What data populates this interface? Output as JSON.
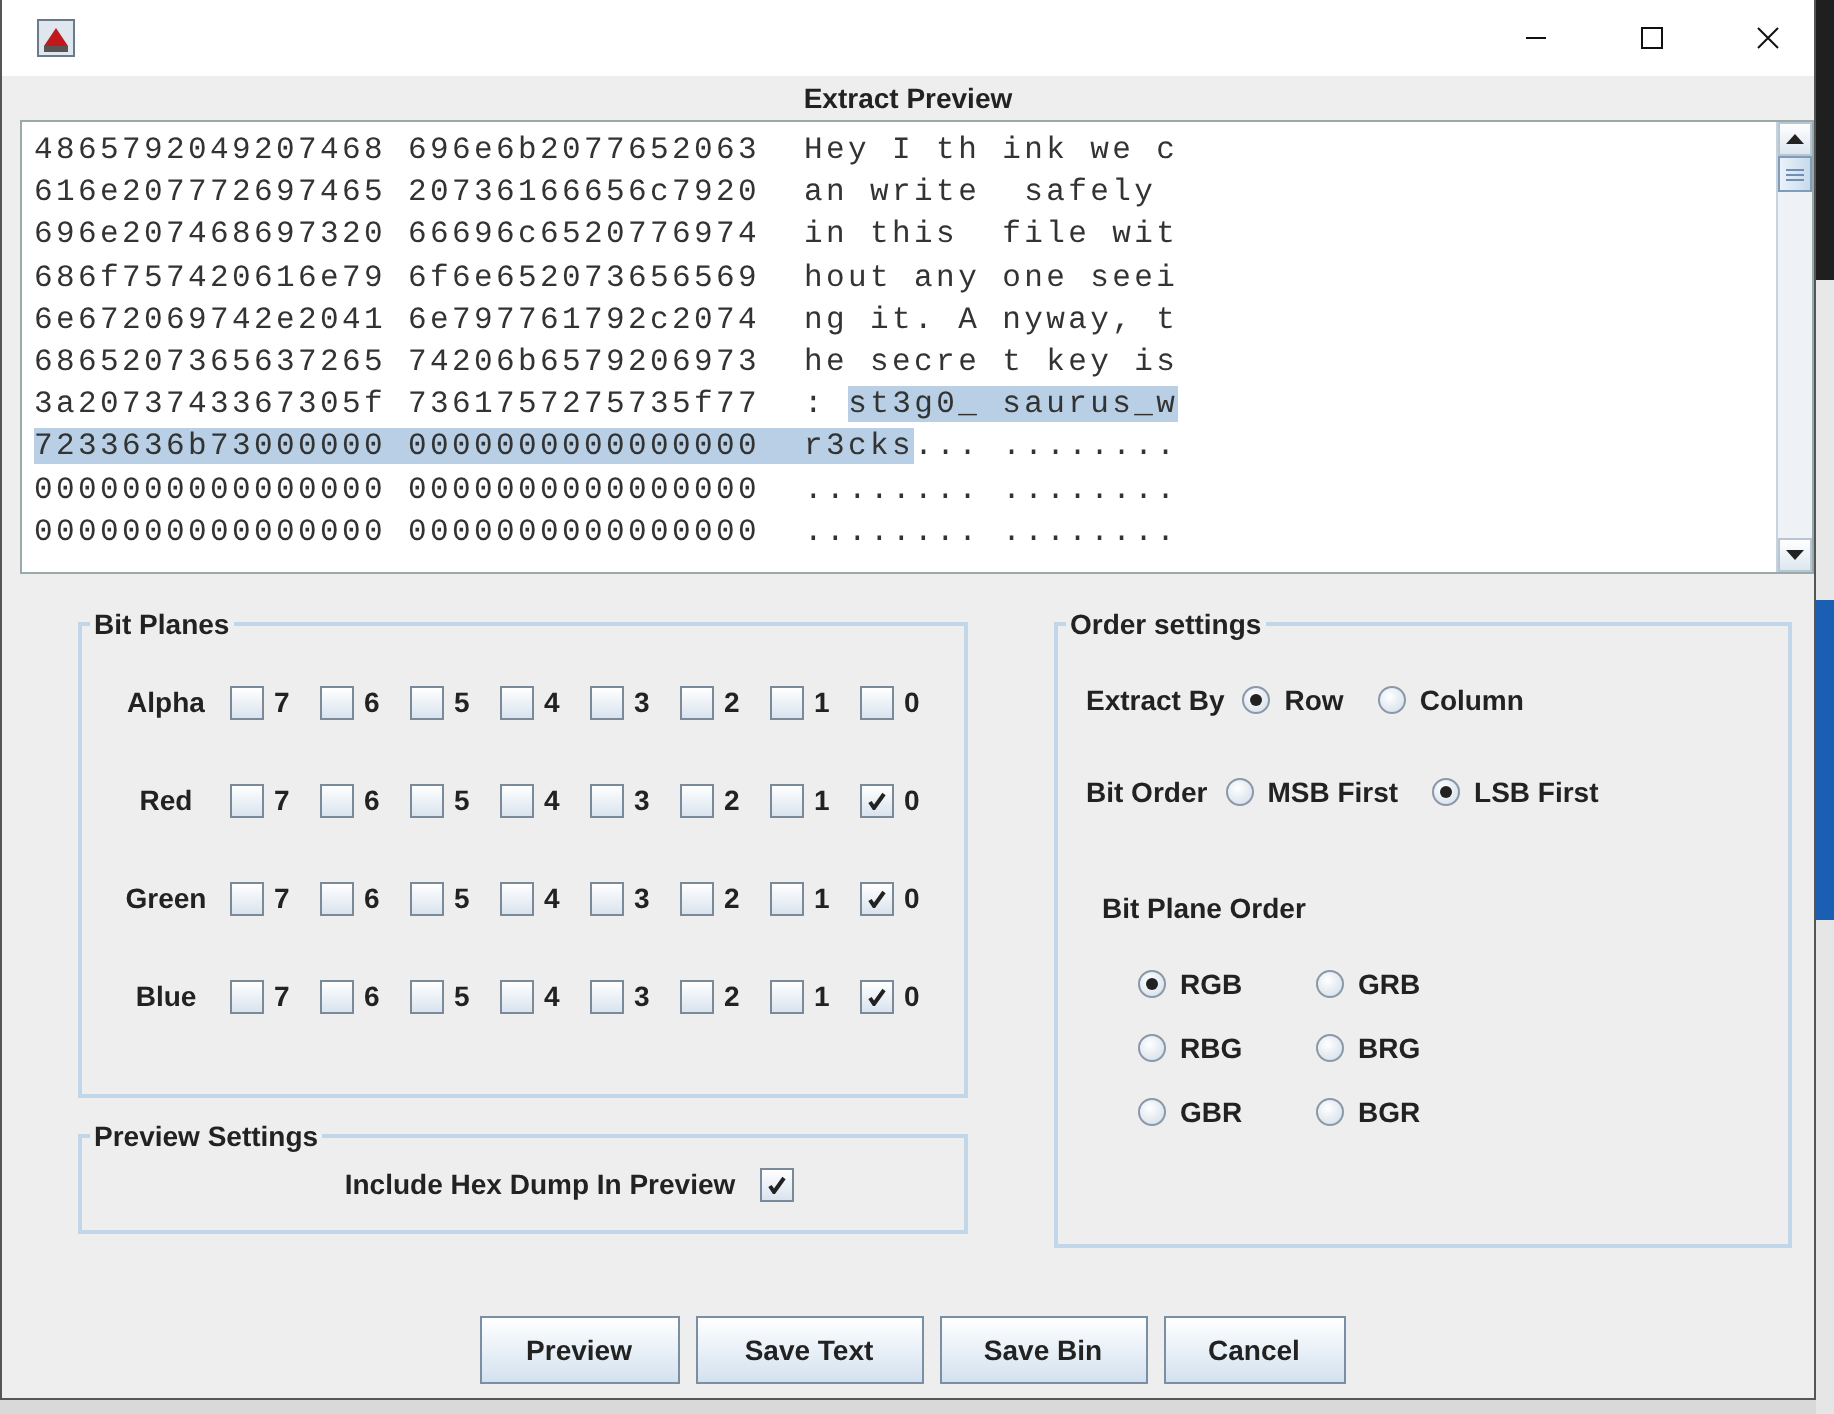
{
  "dialog_heading": "Extract Preview",
  "preview_lines": [
    {
      "segments": [
        {
          "text": "4865792049207468 696e6b2077652063  Hey I th ink we c",
          "selected": false
        }
      ]
    },
    {
      "segments": [
        {
          "text": "616e207772697465 20736166656c7920  an write  safely ",
          "selected": false
        }
      ]
    },
    {
      "segments": [
        {
          "text": "696e207468697320 66696c6520776974  in this  file wit",
          "selected": false
        }
      ]
    },
    {
      "segments": [
        {
          "text": "686f757420616e79 6f6e652073656569  hout any one seei",
          "selected": false
        }
      ]
    },
    {
      "segments": [
        {
          "text": "6e672069742e2041 6e797761792c2074  ng it. A nyway, t",
          "selected": false
        }
      ]
    },
    {
      "segments": [
        {
          "text": "6865207365637265 74206b6579206973  he secre t key is",
          "selected": false
        }
      ]
    },
    {
      "segments": [
        {
          "text": "3a2073743367305f 7361757275735f77  : ",
          "selected": false
        },
        {
          "text": "st3g0_ saurus_w",
          "selected": true
        }
      ]
    },
    {
      "segments": [
        {
          "text": "7233636b73000000 0000000000000000  r3cks",
          "selected": true
        },
        {
          "text": "... ........",
          "selected": false
        }
      ]
    },
    {
      "segments": [
        {
          "text": "0000000000000000 0000000000000000  ........ ........",
          "selected": false
        }
      ]
    },
    {
      "segments": [
        {
          "text": "0000000000000000 0000000000000000  ........ ........",
          "selected": false
        }
      ]
    }
  ],
  "bit_planes": {
    "title": "Bit Planes",
    "channels": [
      {
        "name": "Alpha",
        "bits": [
          {
            "label": "7",
            "checked": false
          },
          {
            "label": "6",
            "checked": false
          },
          {
            "label": "5",
            "checked": false
          },
          {
            "label": "4",
            "checked": false
          },
          {
            "label": "3",
            "checked": false
          },
          {
            "label": "2",
            "checked": false
          },
          {
            "label": "1",
            "checked": false
          },
          {
            "label": "0",
            "checked": false
          }
        ]
      },
      {
        "name": "Red",
        "bits": [
          {
            "label": "7",
            "checked": false
          },
          {
            "label": "6",
            "checked": false
          },
          {
            "label": "5",
            "checked": false
          },
          {
            "label": "4",
            "checked": false
          },
          {
            "label": "3",
            "checked": false
          },
          {
            "label": "2",
            "checked": false
          },
          {
            "label": "1",
            "checked": false
          },
          {
            "label": "0",
            "checked": true
          }
        ]
      },
      {
        "name": "Green",
        "bits": [
          {
            "label": "7",
            "checked": false
          },
          {
            "label": "6",
            "checked": false
          },
          {
            "label": "5",
            "checked": false
          },
          {
            "label": "4",
            "checked": false
          },
          {
            "label": "3",
            "checked": false
          },
          {
            "label": "2",
            "checked": false
          },
          {
            "label": "1",
            "checked": false
          },
          {
            "label": "0",
            "checked": true
          }
        ]
      },
      {
        "name": "Blue",
        "bits": [
          {
            "label": "7",
            "checked": false
          },
          {
            "label": "6",
            "checked": false
          },
          {
            "label": "5",
            "checked": false
          },
          {
            "label": "4",
            "checked": false
          },
          {
            "label": "3",
            "checked": false
          },
          {
            "label": "2",
            "checked": false
          },
          {
            "label": "1",
            "checked": false
          },
          {
            "label": "0",
            "checked": true
          }
        ]
      }
    ]
  },
  "preview_settings": {
    "title": "Preview Settings",
    "hex_dump": {
      "label": "Include Hex Dump In Preview",
      "checked": true
    }
  },
  "order_settings": {
    "title": "Order settings",
    "extract_by": {
      "label": "Extract By",
      "options": [
        {
          "label": "Row",
          "selected": true
        },
        {
          "label": "Column",
          "selected": false
        }
      ]
    },
    "bit_order": {
      "label": "Bit Order",
      "options": [
        {
          "label": "MSB First",
          "selected": false
        },
        {
          "label": "LSB First",
          "selected": true
        }
      ]
    },
    "bit_plane_order": {
      "label": "Bit Plane Order",
      "options": [
        {
          "label": "RGB",
          "selected": true
        },
        {
          "label": "GRB",
          "selected": false
        },
        {
          "label": "RBG",
          "selected": false
        },
        {
          "label": "BRG",
          "selected": false
        },
        {
          "label": "GBR",
          "selected": false
        },
        {
          "label": "BGR",
          "selected": false
        }
      ]
    }
  },
  "buttons": [
    "Preview",
    "Save Text",
    "Save Bin",
    "Cancel"
  ]
}
